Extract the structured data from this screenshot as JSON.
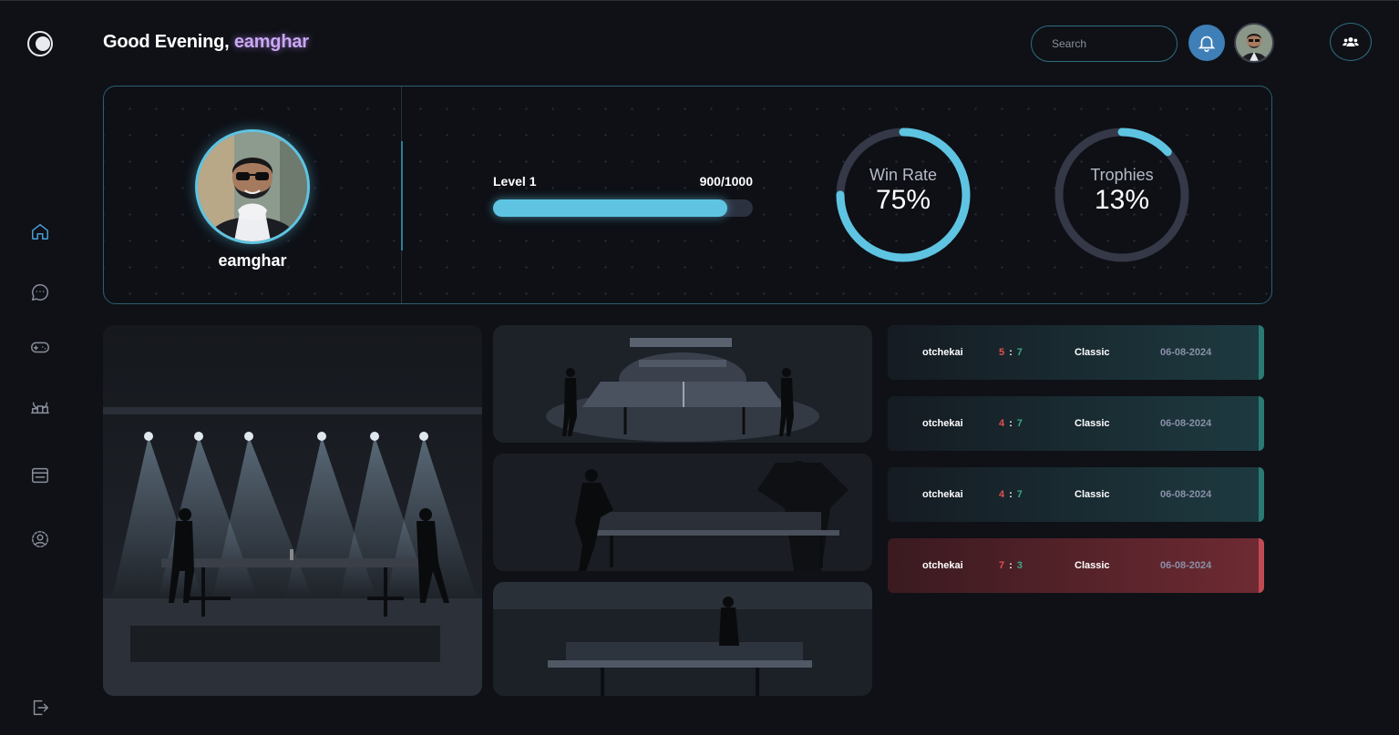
{
  "header": {
    "greeting_prefix": "Good Evening,",
    "username": "eamghar",
    "search_placeholder": "Search"
  },
  "sidebar": {
    "items": [
      {
        "name": "home",
        "active": true
      },
      {
        "name": "chat",
        "active": false
      },
      {
        "name": "game",
        "active": false
      },
      {
        "name": "leaderboard",
        "active": false
      },
      {
        "name": "store",
        "active": false
      },
      {
        "name": "profile",
        "active": false
      },
      {
        "name": "logout",
        "active": false
      }
    ]
  },
  "profile": {
    "name": "eamghar",
    "level_label": "Level 1",
    "xp_text": "900/1000",
    "xp_fraction": 0.9,
    "win_rate": {
      "label": "Win Rate",
      "value_text": "75%",
      "fraction": 0.75
    },
    "trophies": {
      "label": "Trophies",
      "value_text": "13%",
      "fraction": 0.13
    }
  },
  "matches": [
    {
      "opponent": "otchekai",
      "score_a": "5",
      "score_b": "7",
      "mode": "Classic",
      "date": "06-08-2024",
      "result": "win"
    },
    {
      "opponent": "otchekai",
      "score_a": "4",
      "score_b": "7",
      "mode": "Classic",
      "date": "06-08-2024",
      "result": "win"
    },
    {
      "opponent": "otchekai",
      "score_a": "4",
      "score_b": "7",
      "mode": "Classic",
      "date": "06-08-2024",
      "result": "win"
    },
    {
      "opponent": "otchekai",
      "score_a": "7",
      "score_b": "3",
      "mode": "Classic",
      "date": "06-08-2024",
      "result": "loss"
    }
  ],
  "colors": {
    "accent": "#5ec4e2",
    "ring_track": "#343847",
    "win": "#2a7a72",
    "loss": "#c04a52"
  }
}
